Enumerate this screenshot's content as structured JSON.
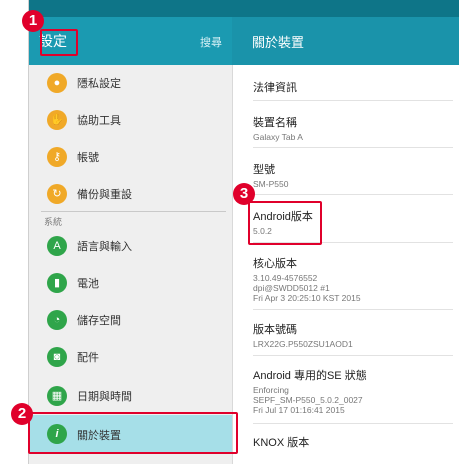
{
  "left_header": {
    "title": "設定",
    "search": "搜尋"
  },
  "right_header": {
    "title": "關於裝置"
  },
  "menu": [
    {
      "label": "隱私設定",
      "icon": "lock-icon",
      "color": "#f0a928"
    },
    {
      "label": "協助工具",
      "icon": "hand-icon",
      "color": "#f0a928"
    },
    {
      "label": "帳號",
      "icon": "key-icon",
      "color": "#f0a928"
    },
    {
      "label": "備份與重設",
      "icon": "backup-icon",
      "color": "#f0a928"
    },
    {
      "label": "語言與輸入",
      "icon": "language-icon",
      "color": "#2fa54a"
    },
    {
      "label": "電池",
      "icon": "battery-icon",
      "color": "#2fa54a"
    },
    {
      "label": "儲存空間",
      "icon": "storage-icon",
      "color": "#2fa54a"
    },
    {
      "label": "配件",
      "icon": "accessory-icon",
      "color": "#2fa54a"
    },
    {
      "label": "日期與時間",
      "icon": "calendar-icon",
      "color": "#2fa54a"
    },
    {
      "label": "關於裝置",
      "icon": "info-icon",
      "color": "#2fa54a"
    }
  ],
  "section_label": "系統",
  "about": [
    {
      "title": "法律資訊",
      "lines": []
    },
    {
      "title": "裝置名稱",
      "lines": [
        "Galaxy Tab A"
      ]
    },
    {
      "title": "型號",
      "lines": [
        "SM-P550"
      ]
    },
    {
      "title": "Android版本",
      "lines": [
        "5.0.2"
      ]
    },
    {
      "title": "核心版本",
      "lines": [
        "3.10.49-4576552",
        "dpi@SWDD5012 #1",
        "Fri Apr 3 20:25:10 KST 2015"
      ]
    },
    {
      "title": "版本號碼",
      "lines": [
        "LRX22G.P550ZSU1AOD1"
      ]
    },
    {
      "title": "Android 專用的SE 狀態",
      "lines": [
        "Enforcing",
        "SEPF_SM-P550_5.0.2_0027",
        "Fri Jul 17 01:16:41 2015"
      ]
    },
    {
      "title": "KNOX 版本",
      "lines": []
    }
  ],
  "badges": [
    "1",
    "2",
    "3"
  ],
  "colors": {
    "highlight": "#a6dfe8",
    "marker": "#e0002b",
    "header": "#1b9ab1"
  }
}
